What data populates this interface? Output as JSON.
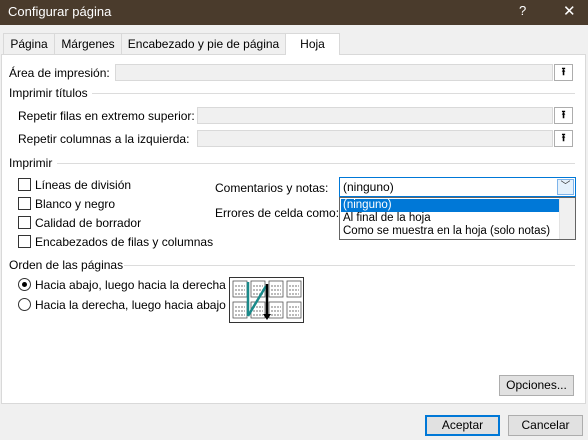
{
  "window": {
    "title": "Configurar página",
    "help_glyph": "?",
    "close_glyph": "✕"
  },
  "tabs": [
    {
      "label": "Página"
    },
    {
      "label": "Márgenes"
    },
    {
      "label": "Encabezado y pie de página"
    },
    {
      "label": "Hoja"
    }
  ],
  "print_area": {
    "label": "Área de impresión:",
    "value": ""
  },
  "print_titles": {
    "section": "Imprimir títulos",
    "rows_label": "Repetir filas en extremo superior:",
    "rows_value": "",
    "cols_label": "Repetir columnas a la izquierda:",
    "cols_value": ""
  },
  "print": {
    "section": "Imprimir",
    "checkboxes": [
      {
        "label": "Líneas de división",
        "checked": false
      },
      {
        "label": "Blanco y negro",
        "checked": false
      },
      {
        "label": "Calidad de borrador",
        "checked": false
      },
      {
        "label": "Encabezados de filas y columnas",
        "checked": false
      }
    ],
    "comments_label": "Comentarios y notas:",
    "comments_value": "(ninguno)",
    "comments_options": [
      "(ninguno)",
      "Al final de la hoja",
      "Como se muestra en la hoja (solo notas)"
    ],
    "errors_label": "Errores de celda como:"
  },
  "page_order": {
    "section": "Orden de las páginas",
    "options": [
      {
        "label": "Hacia abajo, luego hacia la derecha",
        "selected": true
      },
      {
        "label": "Hacia la derecha, luego hacia abajo",
        "selected": false
      }
    ]
  },
  "buttons": {
    "options": "Opciones...",
    "accept": "Aceptar",
    "cancel": "Cancelar"
  },
  "colors": {
    "titlebar": "#4a3b2c",
    "accent": "#0078d7",
    "arrow_teal": "#1a8a8a"
  }
}
